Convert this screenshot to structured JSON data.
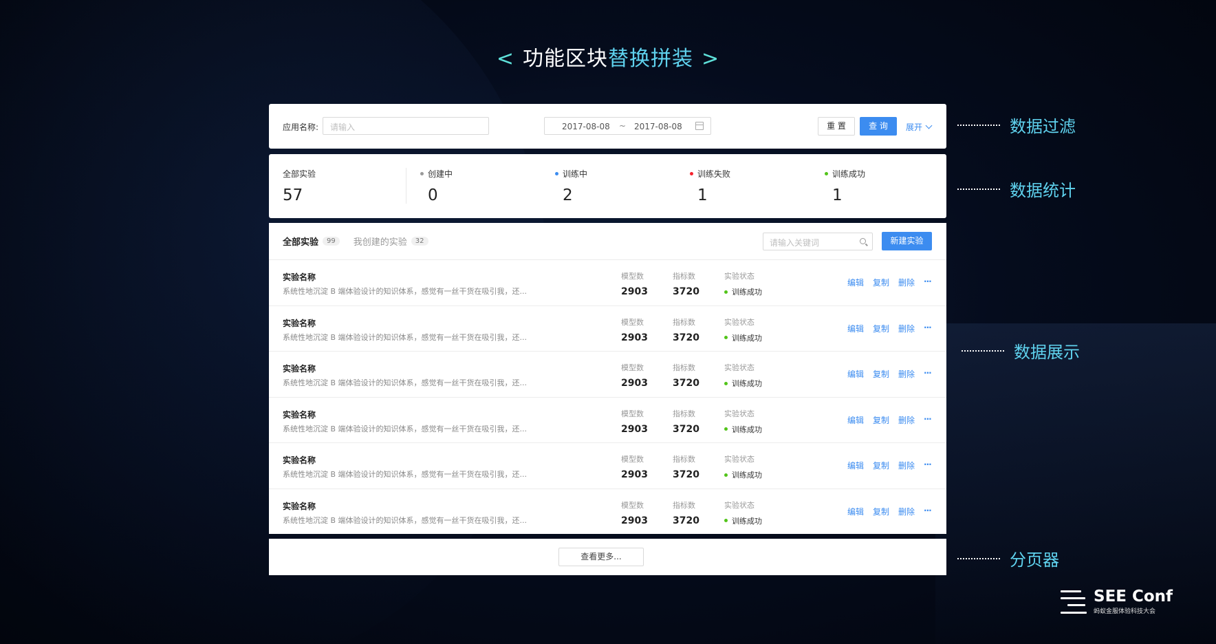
{
  "headline": {
    "left_chevron": "<",
    "part1": "功能区块",
    "part2": "替换拼装",
    "right_chevron": ">"
  },
  "filter": {
    "label": "应用名称:",
    "input_placeholder": "请输入",
    "date_start": "2017-08-08",
    "date_sep": "~",
    "date_end": "2017-08-08",
    "reset_label": "重 置",
    "query_label": "查 询",
    "expand_label": "展开"
  },
  "stats": [
    {
      "label": "全部实验",
      "value": "57",
      "dot": ""
    },
    {
      "label": "创建中",
      "value": "0",
      "dot": "#999999"
    },
    {
      "label": "训练中",
      "value": "2",
      "dot": "#3c8cf0"
    },
    {
      "label": "训练失败",
      "value": "1",
      "dot": "#f5222d"
    },
    {
      "label": "训练成功",
      "value": "1",
      "dot": "#52c41a"
    }
  ],
  "list": {
    "tabs": [
      {
        "label": "全部实验",
        "count": "99"
      },
      {
        "label": "我创建的实验",
        "count": "32"
      }
    ],
    "search_placeholder": "请输入关键词",
    "new_button": "新建实验",
    "col_model": "模型数",
    "col_metric": "指标数",
    "col_status": "实验状态",
    "rows": [
      {
        "title": "实验名称",
        "desc": "系统性地沉淀 B 端体验设计的知识体系，感觉有一丝干货在吸引我，还...",
        "model": "2903",
        "metric": "3720",
        "status": "训练成功"
      },
      {
        "title": "实验名称",
        "desc": "系统性地沉淀 B 端体验设计的知识体系，感觉有一丝干货在吸引我，还...",
        "model": "2903",
        "metric": "3720",
        "status": "训练成功"
      },
      {
        "title": "实验名称",
        "desc": "系统性地沉淀 B 端体验设计的知识体系，感觉有一丝干货在吸引我，还...",
        "model": "2903",
        "metric": "3720",
        "status": "训练成功"
      },
      {
        "title": "实验名称",
        "desc": "系统性地沉淀 B 端体验设计的知识体系，感觉有一丝干货在吸引我，还...",
        "model": "2903",
        "metric": "3720",
        "status": "训练成功"
      },
      {
        "title": "实验名称",
        "desc": "系统性地沉淀 B 端体验设计的知识体系，感觉有一丝干货在吸引我，还...",
        "model": "2903",
        "metric": "3720",
        "status": "训练成功"
      },
      {
        "title": "实验名称",
        "desc": "系统性地沉淀 B 端体验设计的知识体系，感觉有一丝干货在吸引我，还...",
        "model": "2903",
        "metric": "3720",
        "status": "训练成功"
      }
    ],
    "actions": {
      "edit": "编辑",
      "copy": "复制",
      "delete": "删除",
      "more": "···"
    }
  },
  "pager": {
    "more_label": "查看更多..."
  },
  "side_labels": [
    "数据过滤",
    "数据统计",
    "数据展示",
    "分页器"
  ],
  "logo": {
    "name": "SEE Conf",
    "subtitle": "蚂蚁金服体验科技大会"
  },
  "colors": {
    "accent": "#3c8cf0",
    "headline_highlight": "#5fd2ee",
    "success": "#52c41a"
  }
}
